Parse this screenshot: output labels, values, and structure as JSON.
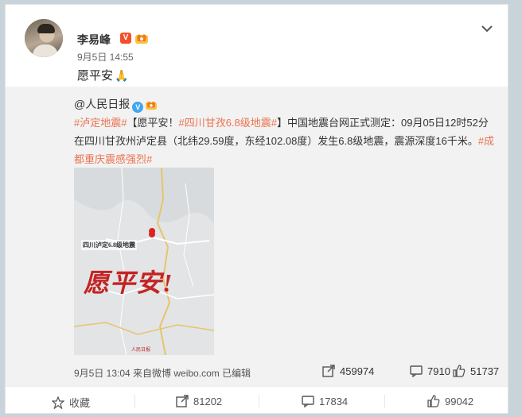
{
  "post": {
    "author": "李易峰",
    "vip_badge": "V",
    "timestamp": "9月5日 14:55",
    "text": "愿平安"
  },
  "repost": {
    "author": "@人民日报",
    "tag1": "#泸定地震#",
    "headline": "【愿平安！",
    "tag2": "#四川甘孜6.8级地震#",
    "body": "】中国地震台网正式测定：09月05日12时52分在四川甘孜州泸定县（北纬29.59度，东经102.08度）发生6.8级地震，震源深度16千米。",
    "tag3": "#成都重庆震感强烈#",
    "image": {
      "caption": "四川泸定6.8级地震",
      "big_text": "愿平安!",
      "logo": "人民日报"
    },
    "footer": "9月5日 13:04 来自微博 weibo.com 已编辑",
    "stats": {
      "reposts": "459974",
      "comments": "7910",
      "likes": "51737"
    }
  },
  "actions": {
    "favorite": "收藏",
    "reposts": "81202",
    "comments": "17834",
    "likes": "99042"
  },
  "colors": {
    "accent_tag": "#eb7350",
    "badge_red": "#f24f2c",
    "verify_blue": "#3fa7ef"
  }
}
